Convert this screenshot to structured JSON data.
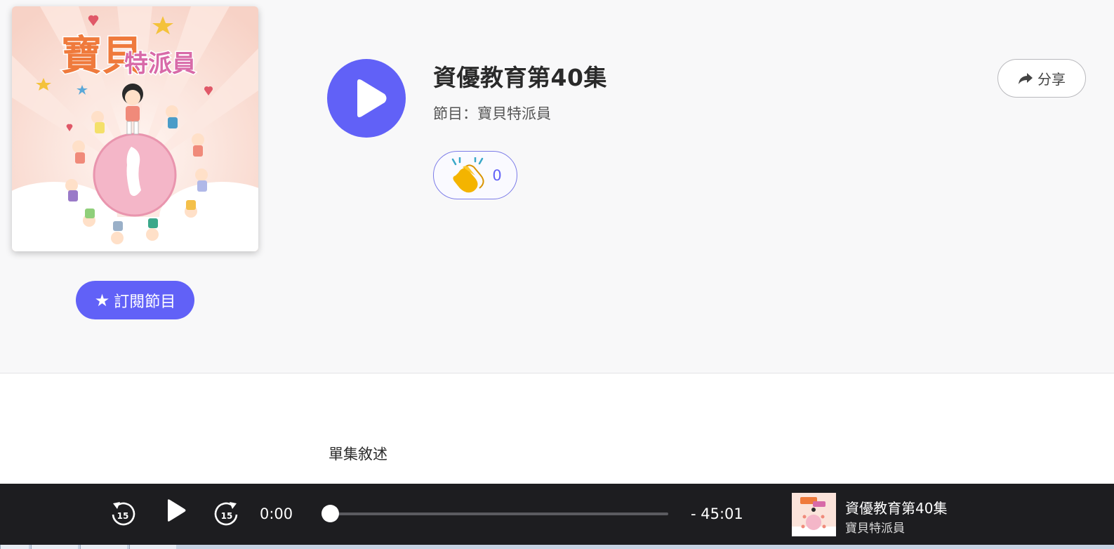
{
  "episode": {
    "title": "資優教育第40集",
    "program_label": "節目：寶貝特派員",
    "cover_title_line1": "寶貝",
    "cover_title_line2": "特派員"
  },
  "actions": {
    "subscribe_label": "訂閱節目",
    "share_label": "分享",
    "clap_count": "0"
  },
  "description": {
    "heading": "單集敘述"
  },
  "player": {
    "current_time": "0:00",
    "remaining_time": "-  45:01",
    "progress": 0,
    "rewind_seconds": "15",
    "forward_seconds": "15",
    "now_playing_title": "資優教育第40集",
    "now_playing_program": "寶貝特派員"
  },
  "colors": {
    "accent": "#6161f7",
    "player_bg": "#1d1d20",
    "hero_bg": "#f8f8f9"
  },
  "icons": {
    "play": "play-icon",
    "share": "share-arrow-icon",
    "clap": "clapping-hands-icon",
    "star": "star-icon",
    "rewind": "rewind-15-icon",
    "forward": "forward-15-icon"
  }
}
